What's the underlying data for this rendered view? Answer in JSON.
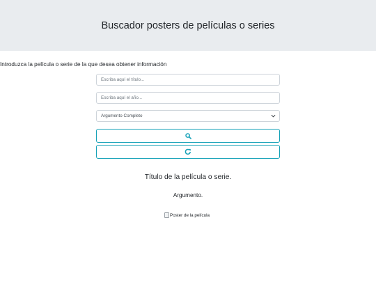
{
  "header": {
    "title": "Buscador posters de películas o series"
  },
  "form": {
    "intro": "Introduzca la película o serie de la que desea obtener información",
    "title_placeholder": "Escriba aquí el título...",
    "year_placeholder": "Escriba aquí el año...",
    "plot_selected": "Argumento Completo"
  },
  "buttons": {
    "search_icon": "search-icon",
    "reset_icon": "redo-icon",
    "accent": "#17a2b8"
  },
  "result": {
    "title": "Título de la película o serie.",
    "argument": "Argumento.",
    "poster_alt": "Poster de la película"
  }
}
